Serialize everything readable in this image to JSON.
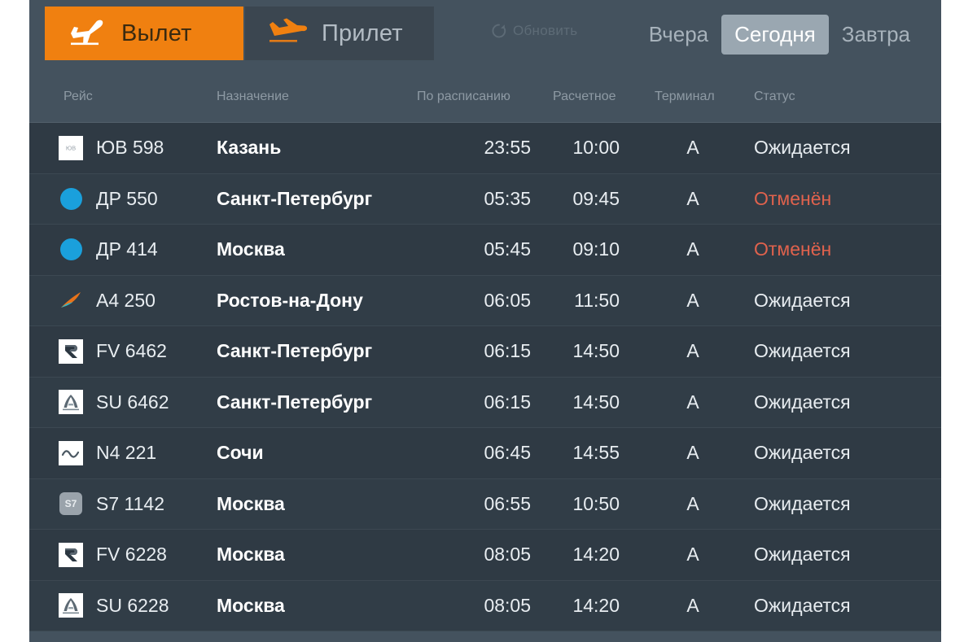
{
  "header": {
    "tabs": [
      {
        "id": "departure",
        "label": "Вылет",
        "icon": "plane-departure-icon",
        "active": true
      },
      {
        "id": "arrival",
        "label": "Прилет",
        "icon": "plane-arrival-icon",
        "active": false
      }
    ],
    "refresh": {
      "label": "Обновить",
      "icon": "refresh-icon"
    },
    "days": [
      {
        "id": "yesterday",
        "label": "Вчера",
        "active": false
      },
      {
        "id": "today",
        "label": "Сегодня",
        "active": true
      },
      {
        "id": "tomorrow",
        "label": "Завтра",
        "active": false
      }
    ]
  },
  "table": {
    "columns": {
      "flight": "Рейс",
      "destination": "Назначение",
      "scheduled": "По расписанию",
      "estimated": "Расчетное",
      "terminal": "Терминал",
      "status": "Статус"
    },
    "rows": [
      {
        "logo": "yuv-logo-icon",
        "logo_type": "square-white",
        "logo_text": "ЮВ",
        "flight": "ЮВ 598",
        "destination": "Казань",
        "scheduled": "23:55",
        "estimated": "10:00",
        "terminal": "A",
        "status": "Ожидается",
        "cancelled": false
      },
      {
        "logo": "dr-logo-icon",
        "logo_type": "blue-dot",
        "logo_text": "",
        "flight": "ДР 550",
        "destination": "Санкт-Петербург",
        "scheduled": "05:35",
        "estimated": "09:45",
        "terminal": "A",
        "status": "Отменён",
        "cancelled": true
      },
      {
        "logo": "dr-logo-icon",
        "logo_type": "blue-dot",
        "logo_text": "",
        "flight": "ДР 414",
        "destination": "Москва",
        "scheduled": "05:45",
        "estimated": "09:10",
        "terminal": "A",
        "status": "Отменён",
        "cancelled": true
      },
      {
        "logo": "azimuth-logo-icon",
        "logo_type": "swoosh",
        "logo_text": "",
        "flight": "A4 250",
        "destination": "Ростов-на-Дону",
        "scheduled": "06:05",
        "estimated": "11:50",
        "terminal": "A",
        "status": "Ожидается",
        "cancelled": false
      },
      {
        "logo": "rossiya-logo-icon",
        "logo_type": "square-r",
        "logo_text": "",
        "flight": "FV 6462",
        "destination": "Санкт-Петербург",
        "scheduled": "06:15",
        "estimated": "14:50",
        "terminal": "A",
        "status": "Ожидается",
        "cancelled": false
      },
      {
        "logo": "aeroflot-logo-icon",
        "logo_type": "square-a",
        "logo_text": "",
        "flight": "SU 6462",
        "destination": "Санкт-Петербург",
        "scheduled": "06:15",
        "estimated": "14:50",
        "terminal": "A",
        "status": "Ожидается",
        "cancelled": false
      },
      {
        "logo": "nordwind-logo-icon",
        "logo_type": "square-wave",
        "logo_text": "",
        "flight": "N4 221",
        "destination": "Сочи",
        "scheduled": "06:45",
        "estimated": "14:55",
        "terminal": "A",
        "status": "Ожидается",
        "cancelled": false
      },
      {
        "logo": "s7-logo-icon",
        "logo_type": "s7",
        "logo_text": "S7",
        "flight": "S7 1142",
        "destination": "Москва",
        "scheduled": "06:55",
        "estimated": "10:50",
        "terminal": "A",
        "status": "Ожидается",
        "cancelled": false
      },
      {
        "logo": "rossiya-logo-icon",
        "logo_type": "square-r",
        "logo_text": "",
        "flight": "FV 6228",
        "destination": "Москва",
        "scheduled": "08:05",
        "estimated": "14:20",
        "terminal": "A",
        "status": "Ожидается",
        "cancelled": false
      },
      {
        "logo": "aeroflot-logo-icon",
        "logo_type": "square-a",
        "logo_text": "",
        "flight": "SU 6228",
        "destination": "Москва",
        "scheduled": "08:05",
        "estimated": "14:20",
        "terminal": "A",
        "status": "Ожидается",
        "cancelled": false
      }
    ]
  },
  "colors": {
    "accent": "#f08010",
    "board_bg": "#44525e",
    "row_bg": "#2f3a44",
    "cancelled": "#e0624d",
    "day_active_bg": "#9aa7b1",
    "logo_blue": "#1aa0dc"
  }
}
